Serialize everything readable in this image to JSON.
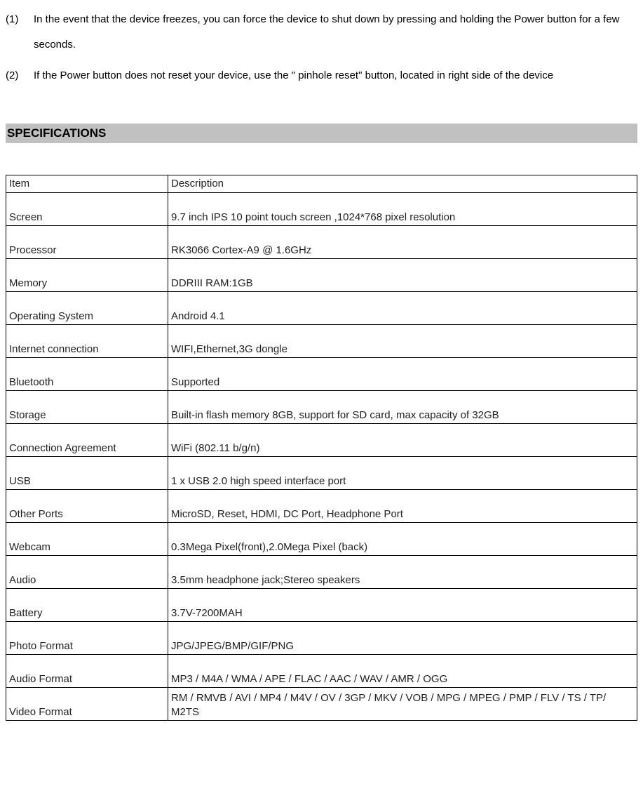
{
  "list": [
    {
      "marker": "(1)",
      "text": "In the event that the device freezes, you can force the device to shut down by pressing and holding the Power button for a few seconds."
    },
    {
      "marker": "(2)",
      "text": "If the Power button does not reset your device, use the \" pinhole reset\" button, located in right side of the device"
    }
  ],
  "heading": "SPECIFICATIONS",
  "table": {
    "header": {
      "item": "Item",
      "desc": "Description"
    },
    "rows": [
      {
        "item": "Screen",
        "desc": "9.7 inch IPS 10 point touch screen ,1024*768 pixel resolution"
      },
      {
        "item": "Processor",
        "desc": "RK3066 Cortex-A9 @ 1.6GHz"
      },
      {
        "item": "Memory",
        "desc": "DDRIII RAM:1GB"
      },
      {
        "item": "Operating System",
        "desc": "Android 4.1"
      },
      {
        "item": "Internet connection",
        "desc": "WIFI,Ethernet,3G dongle"
      },
      {
        "item": "Bluetooth",
        "desc": "Supported"
      },
      {
        "item": "Storage",
        "desc": "Built-in flash memory 8GB, support for SD card, max capacity of 32GB"
      },
      {
        "item": "Connection Agreement",
        "desc": "WiFi (802.11 b/g/n)"
      },
      {
        "item": "USB",
        "desc": "1 x USB 2.0 high speed interface port"
      },
      {
        "item": "Other Ports",
        "desc": "MicroSD, Reset, HDMI, DC Port, Headphone Port"
      },
      {
        "item": "Webcam",
        "desc": "0.3Mega Pixel(front),2.0Mega Pixel (back)"
      },
      {
        "item": "Audio",
        "desc": "3.5mm headphone jack;Stereo speakers"
      },
      {
        "item": "Battery",
        "desc": "3.7V-7200MAH"
      },
      {
        "item": "Photo Format",
        "desc": "JPG/JPEG/BMP/GIF/PNG"
      },
      {
        "item": "Audio Format",
        "desc": "MP3 / M4A / WMA  / APE / FLAC / AAC / WAV / AMR / OGG"
      },
      {
        "item": "Video Format",
        "desc": "RM / RMVB / AVI / MP4 / M4V / OV / 3GP / MKV / VOB / MPG / MPEG / PMP / FLV / TS / TP/ M2TS"
      }
    ]
  }
}
